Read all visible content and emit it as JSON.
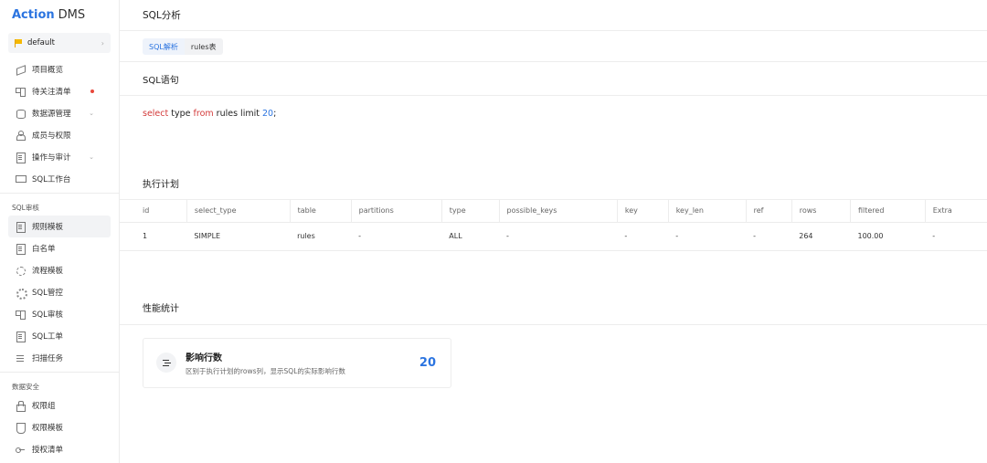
{
  "logo": {
    "brand": "Action",
    "product": "DMS"
  },
  "workspace": {
    "name": "default"
  },
  "sidebar": {
    "top_items": [
      {
        "label": "项目概览",
        "icon": "layers-icon"
      },
      {
        "label": "待关注清单",
        "icon": "grid-icon"
      },
      {
        "label": "数据源管理",
        "icon": "database-icon"
      },
      {
        "label": "成员与权限",
        "icon": "people-icon"
      },
      {
        "label": "操作与审计",
        "icon": "audit-doc-icon"
      },
      {
        "label": "SQL工作台",
        "icon": "monitor-icon"
      }
    ],
    "sections": [
      {
        "title": "SQL审核",
        "items": [
          {
            "label": "规则模板"
          },
          {
            "label": "白名单"
          },
          {
            "label": "流程模板"
          },
          {
            "label": "SQL管控"
          },
          {
            "label": "SQL审核"
          },
          {
            "label": "SQL工单"
          },
          {
            "label": "扫描任务"
          }
        ]
      },
      {
        "title": "数据安全",
        "items": [
          {
            "label": "权限组"
          },
          {
            "label": "权限模板"
          },
          {
            "label": "授权清单"
          }
        ]
      }
    ]
  },
  "page": {
    "title": "SQL分析"
  },
  "tabs": [
    {
      "label": "SQL解析"
    },
    {
      "label": "rules表"
    }
  ],
  "sql_section": {
    "title": "SQL语句",
    "tokens": [
      "select",
      "type",
      "from",
      "rules limit",
      "20",
      ";"
    ]
  },
  "plan_section": {
    "title": "执行计划",
    "columns": [
      "id",
      "select_type",
      "table",
      "partitions",
      "type",
      "possible_keys",
      "key",
      "key_len",
      "ref",
      "rows",
      "filtered",
      "Extra"
    ],
    "rows": [
      [
        "1",
        "SIMPLE",
        "rules",
        "-",
        "ALL",
        "-",
        "-",
        "-",
        "-",
        "264",
        "100.00",
        "-"
      ]
    ]
  },
  "perf_section": {
    "title": "性能统计",
    "card": {
      "title": "影响行数",
      "desc": "区别于执行计划的rows列，显示SQL的实际影响行数",
      "value": "20"
    }
  },
  "colors": {
    "accent": "#2b74e0",
    "keyword": "#d33a3a",
    "badge": "#e8473b",
    "flag": "#f5b800"
  }
}
